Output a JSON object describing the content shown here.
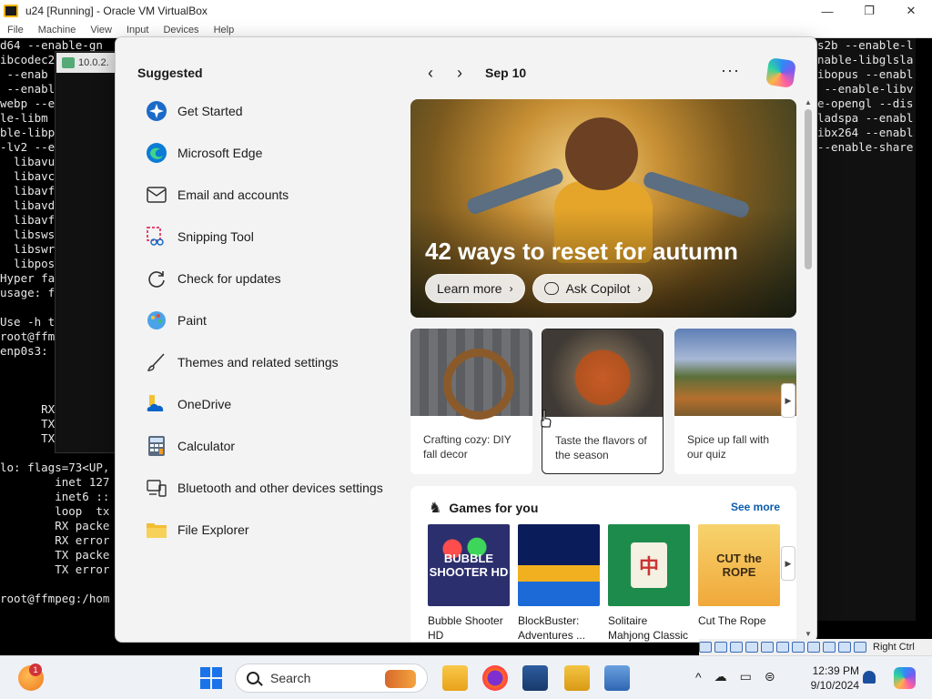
{
  "window": {
    "title": "u24 [Running] - Oracle VM VirtualBox",
    "controls": {
      "minimize": "—",
      "maximize": "❐",
      "close": "✕"
    },
    "menu": [
      "File",
      "Machine",
      "View",
      "Input",
      "Devices",
      "Help"
    ]
  },
  "console": {
    "left_lines": [
      "d64 --enable-gn",
      "ibcodec2",
      " --enab",
      " --enable",
      "webp --e",
      "le-libm",
      "ble-libp",
      "-lv2 --e",
      "  libavu",
      "  libavc",
      "  libavf",
      "  libavd",
      "  libavf",
      "  libsws",
      "  libswr",
      "  libpos",
      "Hyper fa",
      "usage: f",
      "",
      "Use -h t",
      "root@ffm",
      "enp0s3:",
      "",
      "",
      "",
      "      RX errors",
      "      TX packe",
      "      TX error",
      "",
      "lo: flags=73<UP,",
      "        inet 127",
      "        inet6 ::",
      "        loop  tx",
      "        RX packe",
      "        RX error",
      "        TX packe",
      "        TX error",
      "",
      "root@ffmpeg:/hom"
    ],
    "right_lines": [
      "s2b --enable-l",
      "nable-libglsla",
      "ibopus --enabl",
      " --enable-libv",
      "e-opengl --dis",
      "ladspa --enabl",
      "ibx264 --enabl",
      "--enable-share"
    ],
    "remote_tab": "10.0.2."
  },
  "start_menu": {
    "suggested_title": "Suggested",
    "suggested": [
      {
        "label": "Get Started",
        "icon": "get-started-icon"
      },
      {
        "label": "Microsoft Edge",
        "icon": "edge-icon"
      },
      {
        "label": "Email and accounts",
        "icon": "mail-icon"
      },
      {
        "label": "Snipping Tool",
        "icon": "scissors-icon"
      },
      {
        "label": "Check for updates",
        "icon": "refresh-icon"
      },
      {
        "label": "Paint",
        "icon": "paint-palette-icon"
      },
      {
        "label": "Themes and related settings",
        "icon": "brush-icon"
      },
      {
        "label": "OneDrive",
        "icon": "cloud-icon"
      },
      {
        "label": "Calculator",
        "icon": "calculator-icon"
      },
      {
        "label": "Bluetooth and other devices settings",
        "icon": "devices-icon"
      },
      {
        "label": "File Explorer",
        "icon": "folder-icon"
      }
    ],
    "feed": {
      "prev": "‹",
      "next": "›",
      "date": "Sep 10",
      "more": "···",
      "hero": {
        "title": "42 ways to reset for autumn",
        "learn_more": "Learn more",
        "ask_copilot": "Ask Copilot"
      },
      "cards": [
        {
          "text": "Crafting cozy: DIY fall decor"
        },
        {
          "text": "Taste the flavors of the season"
        },
        {
          "text": "Spice up fall with our quiz"
        }
      ],
      "games": {
        "title": "Games for you",
        "see_more": "See more",
        "items": [
          {
            "label": "Bubble Shooter HD",
            "art": "BUBBLE SHOOTER HD"
          },
          {
            "label": "BlockBuster: Adventures ...",
            "art": ""
          },
          {
            "label": "Solitaire Mahjong Classic",
            "art": "中"
          },
          {
            "label": "Cut The Rope",
            "art": "CUT the ROPE"
          }
        ]
      }
    }
  },
  "vbox_status": {
    "host_key": "Right Ctrl"
  },
  "taskbar": {
    "weather_badge": "1",
    "search_placeholder": "Search",
    "tray": {
      "chevron": "^",
      "time": "12:39 PM",
      "date": "9/10/2024"
    }
  }
}
